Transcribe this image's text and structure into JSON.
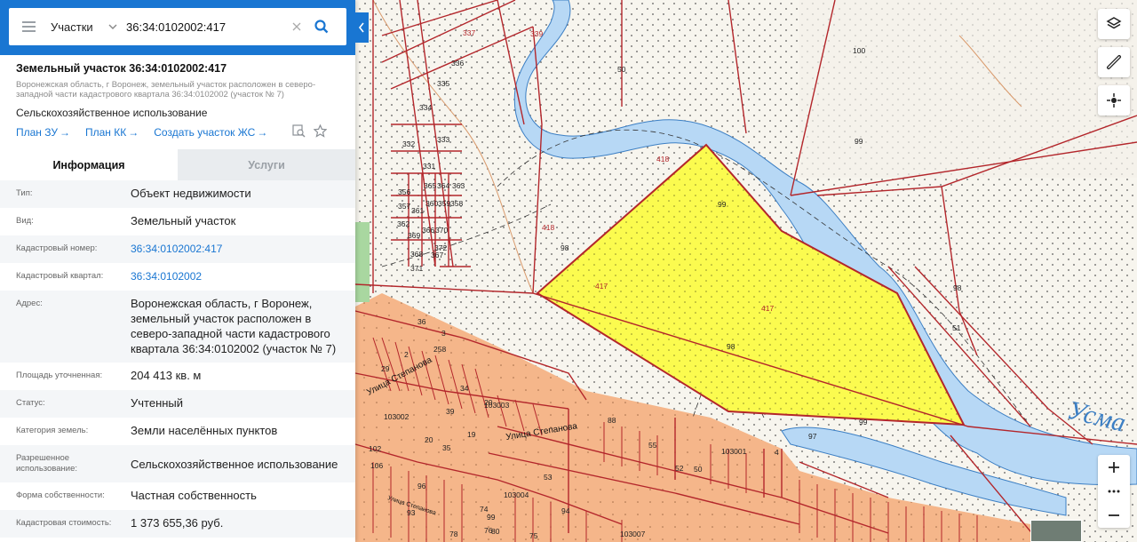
{
  "search": {
    "type_label": "Участки",
    "value": "36:34:0102002:417"
  },
  "object": {
    "title": "Земельный участок 36:34:0102002:417",
    "address_short": "Воронежская область, г Воронеж, земельный участок расположен в северо-западной части кадастрового квартала 36:34:0102002 (участок № 7)",
    "use": "Сельскохозяйственное использование",
    "links": [
      "План ЗУ",
      "План КК",
      "Создать участок ЖС"
    ]
  },
  "tabs": [
    "Информация",
    "Услуги"
  ],
  "info": [
    {
      "label": "Тип:",
      "value": "Объект недвижимости",
      "link": false
    },
    {
      "label": "Вид:",
      "value": "Земельный участок",
      "link": false
    },
    {
      "label": "Кадастровый номер:",
      "value": "36:34:0102002:417",
      "link": true
    },
    {
      "label": "Кадастровый квартал:",
      "value": "36:34:0102002",
      "link": true
    },
    {
      "label": "Адрес:",
      "value": "Воронежская область, г Воронеж, земельный участок расположен в северо-западной части кадастрового квартала 36:34:0102002 (участок № 7)",
      "link": false
    },
    {
      "label": "Площадь уточненная:",
      "value": "204 413 кв. м",
      "link": false
    },
    {
      "label": "Статус:",
      "value": "Учтенный",
      "link": false
    },
    {
      "label": "Категория земель:",
      "value": "Земли населённых пунктов",
      "link": false
    },
    {
      "label": "Разрешенное использование:",
      "value": "Сельскохозяйственное использование",
      "link": false
    },
    {
      "label": "Форма собственности:",
      "value": "Частная собственность",
      "link": false
    },
    {
      "label": "Кадастровая стоимость:",
      "value": "1 373 655,36 руб.",
      "link": false
    }
  ],
  "map": {
    "river_name": "Усма",
    "parcel_labels": [
      "339",
      "337",
      "336",
      "335",
      "334",
      "332",
      "333",
      "331",
      "50",
      "418",
      "418",
      "417",
      "417",
      "99",
      "98",
      "98",
      "98",
      "97",
      "99",
      "99",
      "51",
      "100",
      "363",
      "364",
      "365",
      "356",
      "357",
      "358",
      "359",
      "360",
      "361",
      "362",
      "366",
      "370",
      "369",
      "372",
      "368",
      "367",
      "371",
      "36",
      "3",
      "258",
      "2",
      "29",
      "34",
      "103002",
      "103003",
      "103001",
      "103004",
      "103007",
      "20",
      "88",
      "4",
      "52",
      "50",
      "102",
      "106",
      "96",
      "94",
      "93",
      "76",
      "75",
      "74",
      "80",
      "78",
      "19",
      "20",
      "35",
      "39",
      "53",
      "55",
      "99",
      "8",
      "38"
    ],
    "street_labels": [
      "Улица Степанова",
      "Улица Степанова",
      "Улица Степанова"
    ]
  },
  "colors": {
    "accent": "#1976d2",
    "parcel_fill": "#fbfb4f",
    "boundary": "#b3262b",
    "river": "#b7d8f5",
    "urban": "#f5b68a"
  },
  "icons": [
    "menu-icon",
    "chevron-down-icon",
    "clear-icon",
    "search-icon",
    "collapse-icon",
    "find-on-map-icon",
    "star-icon",
    "layers-icon",
    "ruler-icon",
    "locate-icon",
    "zoom-in-icon",
    "more-icon",
    "zoom-out-icon"
  ]
}
